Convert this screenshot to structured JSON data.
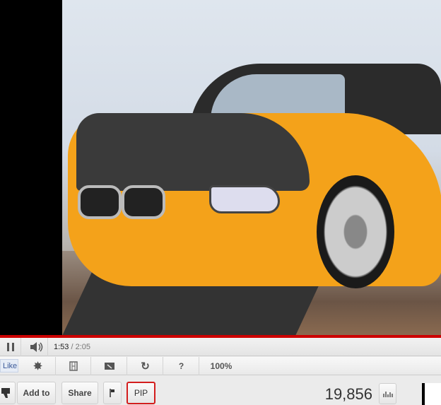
{
  "player": {
    "current_time": "1:53",
    "separator": " / ",
    "duration": "2:05",
    "progress_fraction": 0.904,
    "progress_color": "#cc0000"
  },
  "toolbar": {
    "like_label": "Like",
    "zoom_level": "100%",
    "help_label": "?"
  },
  "actions": {
    "add_to_label": "Add to",
    "share_label": "Share",
    "pip_label": "PIP",
    "view_count": "19,856"
  },
  "icons": [
    "pause-icon",
    "volume-icon",
    "settings-icon",
    "filmstrip-icon",
    "screen-icon",
    "replay-icon",
    "dislike-icon",
    "flag-icon",
    "stats-icon"
  ]
}
